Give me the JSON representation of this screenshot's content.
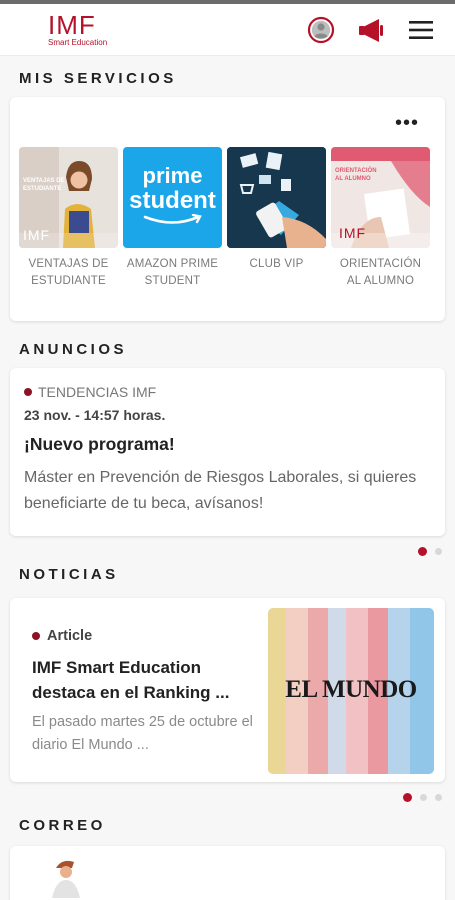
{
  "header": {
    "logo_main": "IMF",
    "logo_sub": "Smart Education",
    "icons": [
      "user-icon",
      "megaphone-icon",
      "menu-icon"
    ],
    "accent": "#b5122a"
  },
  "services": {
    "title": "MIS SERVICIOS",
    "more_label": "•••",
    "items": [
      {
        "label_line1": "VENTAJAS DE",
        "label_line2": "ESTUDIANTE",
        "thumb_caption": "VENTAJAS DE ESTUDIANTE",
        "thumb_logo": "IMF"
      },
      {
        "label_line1": "AMAZON PRIME",
        "label_line2": "STUDENT",
        "thumb_line1": "prime",
        "thumb_line2": "student"
      },
      {
        "label_line1": "CLUB VIP",
        "label_line2": ""
      },
      {
        "label_line1": "ORIENTACIÓN",
        "label_line2": "AL ALUMNO",
        "thumb_caption": "ORIENTACIÓN AL ALUMNO",
        "thumb_logo": "IMF"
      }
    ]
  },
  "announcements": {
    "title": "ANUNCIOS",
    "tag": "TENDENCIAS IMF",
    "date": "23 nov. - 14:57 horas.",
    "headline": "¡Nuevo programa!",
    "body": "Máster en Prevención de Riesgos Laborales, si quieres beneficiarte de tu beca, avísanos!",
    "page_count": 2,
    "active_page": 1
  },
  "news": {
    "title": "NOTICIAS",
    "tag": "Article",
    "headline": "IMF Smart Education destaca en el Ranking ...",
    "body": "El pasado martes 25 de octubre el diario El Mundo ...",
    "image_text": "EL MUNDO",
    "page_count": 3,
    "active_page": 1
  },
  "mail": {
    "title": "CORREO"
  }
}
